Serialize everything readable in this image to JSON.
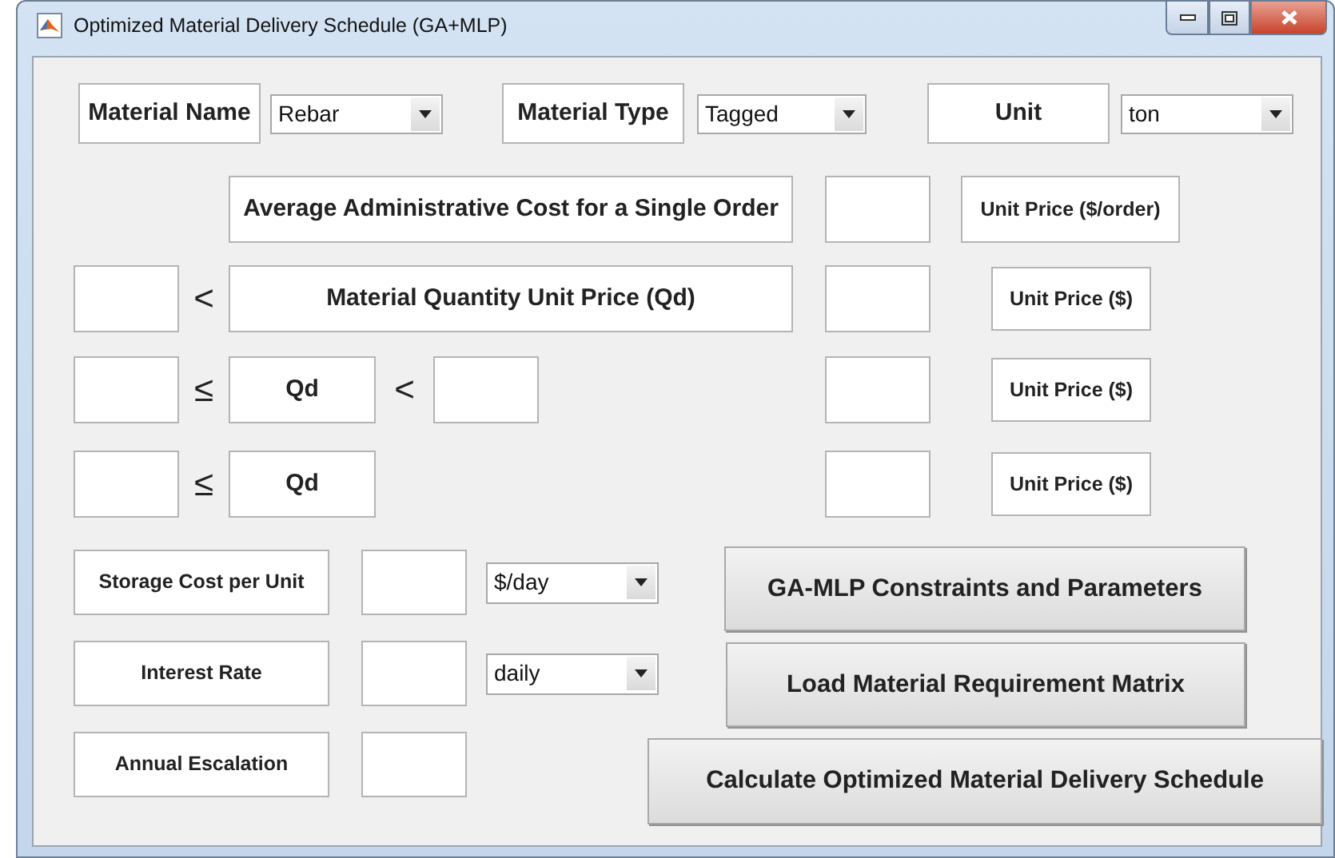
{
  "window": {
    "title": "Optimized Material Delivery Schedule (GA+MLP)"
  },
  "material": [
    {
      "label": "Material Name",
      "value": "Rebar"
    },
    {
      "label": "Material Type",
      "value": "Tagged"
    },
    {
      "label": "Unit",
      "value": "ton"
    }
  ],
  "order_cost": {
    "label": "Average Administrative Cost for a Single Order",
    "unit": "Unit Price ($/order)"
  },
  "price_tiers": [
    {
      "kind": "heading",
      "lower_op": "<",
      "label": "Material Quantity Unit Price (Qd)",
      "unit": "Unit Price ($)"
    },
    {
      "kind": "range",
      "lower_op": "≤",
      "label": "Qd",
      "upper_op": "<",
      "unit": "Unit Price ($)"
    },
    {
      "kind": "open",
      "lower_op": "≤",
      "label": "Qd",
      "unit": "Unit Price ($)"
    }
  ],
  "costs": [
    {
      "label": "Storage Cost per Unit",
      "period": "$/day"
    },
    {
      "label": "Interest Rate",
      "period": "daily"
    },
    {
      "label": "Annual Escalation"
    }
  ],
  "buttons": [
    "GA-MLP Constraints and Parameters",
    "Load Material Requirement Matrix",
    "Calculate Optimized Material Delivery Schedule"
  ]
}
